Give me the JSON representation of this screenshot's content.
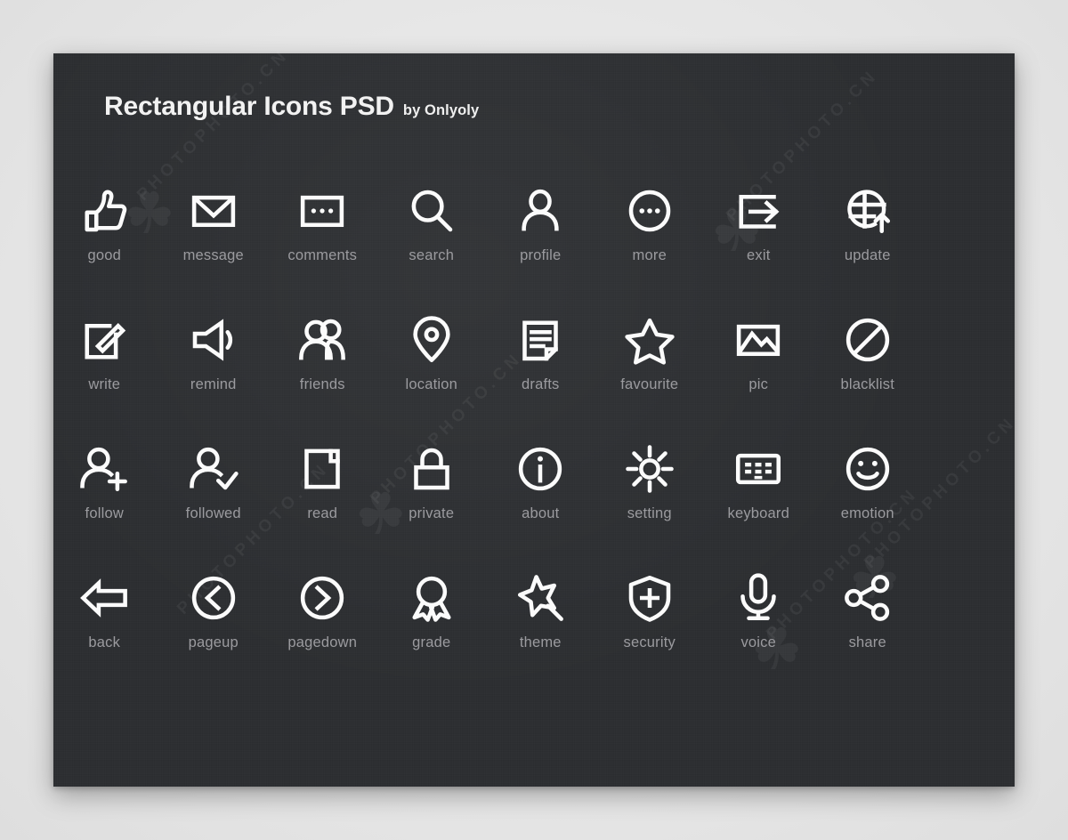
{
  "page": {
    "background_color": "#e9e9e9",
    "panel_color": "#2c2e31",
    "icon_color": "#fbfbfb",
    "label_color": "#9b9b9f"
  },
  "header": {
    "title": "Rectangular Icons PSD",
    "byline": "by Onlyoly"
  },
  "watermarks": [
    {
      "text": "PHOTOPHOTO.CN"
    },
    {
      "text": "PHOTOPHOTO.CN"
    },
    {
      "text": "PHOTOPHOTO.CN"
    },
    {
      "text": "PHOTOPHOTO.CN"
    },
    {
      "text": "PHOTOPHOTO.CN"
    },
    {
      "text": "PHOTOPHOTO.CN"
    }
  ],
  "icons": [
    {
      "label": "good",
      "icon": "thumbs-up-icon"
    },
    {
      "label": "message",
      "icon": "envelope-icon"
    },
    {
      "label": "comments",
      "icon": "comment-box-icon"
    },
    {
      "label": "search",
      "icon": "magnifier-icon"
    },
    {
      "label": "profile",
      "icon": "person-icon"
    },
    {
      "label": "more",
      "icon": "ellipsis-circle-icon"
    },
    {
      "label": "exit",
      "icon": "exit-arrow-icon"
    },
    {
      "label": "update",
      "icon": "globe-up-arrow-icon"
    },
    {
      "label": "write",
      "icon": "pencil-square-icon"
    },
    {
      "label": "remind",
      "icon": "speaker-icon"
    },
    {
      "label": "friends",
      "icon": "two-people-icon"
    },
    {
      "label": "location",
      "icon": "map-pin-icon"
    },
    {
      "label": "drafts",
      "icon": "document-icon"
    },
    {
      "label": "favourite",
      "icon": "star-icon"
    },
    {
      "label": "pic",
      "icon": "picture-icon"
    },
    {
      "label": "blacklist",
      "icon": "prohibition-icon"
    },
    {
      "label": "follow",
      "icon": "person-plus-icon"
    },
    {
      "label": "followed",
      "icon": "person-check-icon"
    },
    {
      "label": "read",
      "icon": "dog-ear-page-icon"
    },
    {
      "label": "private",
      "icon": "padlock-icon"
    },
    {
      "label": "about",
      "icon": "info-circle-icon"
    },
    {
      "label": "setting",
      "icon": "gear-icon"
    },
    {
      "label": "keyboard",
      "icon": "keyboard-icon"
    },
    {
      "label": "emotion",
      "icon": "smiley-icon"
    },
    {
      "label": "back",
      "icon": "left-arrow-icon"
    },
    {
      "label": "pageup",
      "icon": "chevron-left-circle-icon"
    },
    {
      "label": "pagedown",
      "icon": "chevron-right-circle-icon"
    },
    {
      "label": "grade",
      "icon": "medal-icon"
    },
    {
      "label": "theme",
      "icon": "magic-wand-star-icon"
    },
    {
      "label": "security",
      "icon": "shield-plus-icon"
    },
    {
      "label": "voice",
      "icon": "microphone-icon"
    },
    {
      "label": "share",
      "icon": "share-nodes-icon"
    }
  ]
}
